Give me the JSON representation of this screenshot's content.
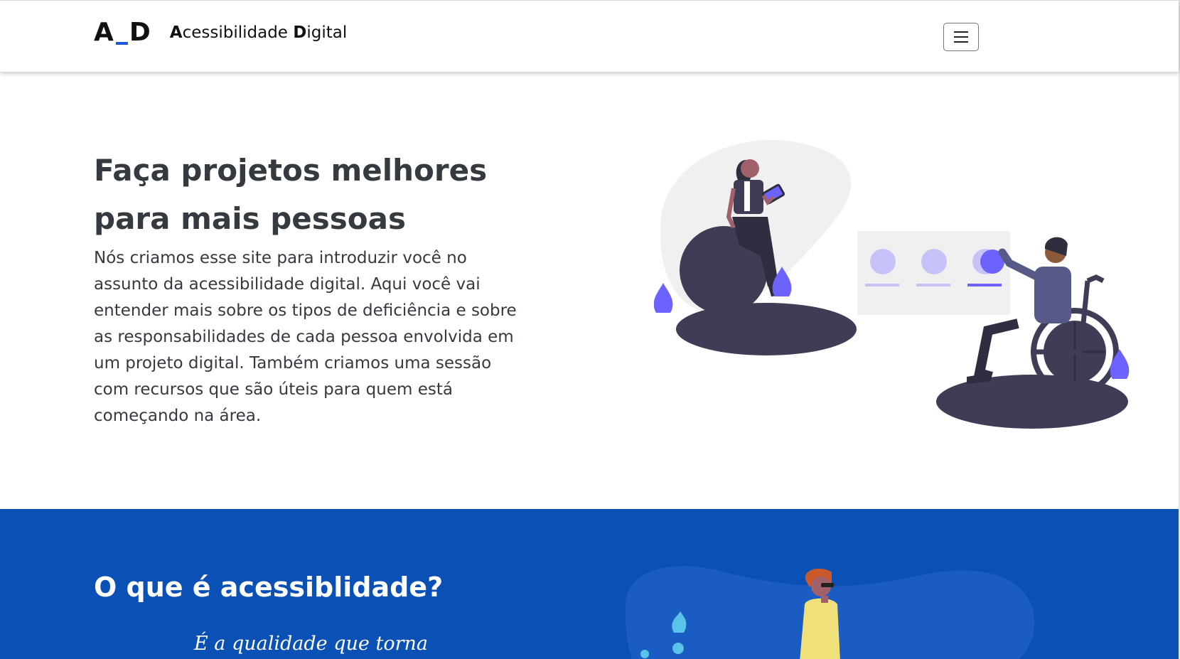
{
  "navbar": {
    "logo_left": "A",
    "logo_right": "D",
    "brand_first_letter": "A",
    "brand_rest1": "cessibilidade ",
    "brand_second_letter": "D",
    "brand_rest2": "igital",
    "menu_icon": "hamburger-menu-icon"
  },
  "hero": {
    "title_line1": "Faça projetos melhores",
    "title_line2": "para mais pessoas",
    "text": "Nós criamos esse site para introduzir você no assunto da acessibilidade digital. Aqui você vai entender mais sobre os tipos de deficiência e sobre as responsabilidades de cada pessoa envolvida em um projeto digital. Também criamos uma sessão com recursos que são úteis para quem está começando na área."
  },
  "section_accessibility": {
    "title": "O que é acessiblidade?",
    "quote": "É a qualidade que torna"
  },
  "colors": {
    "brand_blue": "#0a50b5",
    "accent_purple": "#6c63ff",
    "dark_shape": "#3f3d56"
  }
}
